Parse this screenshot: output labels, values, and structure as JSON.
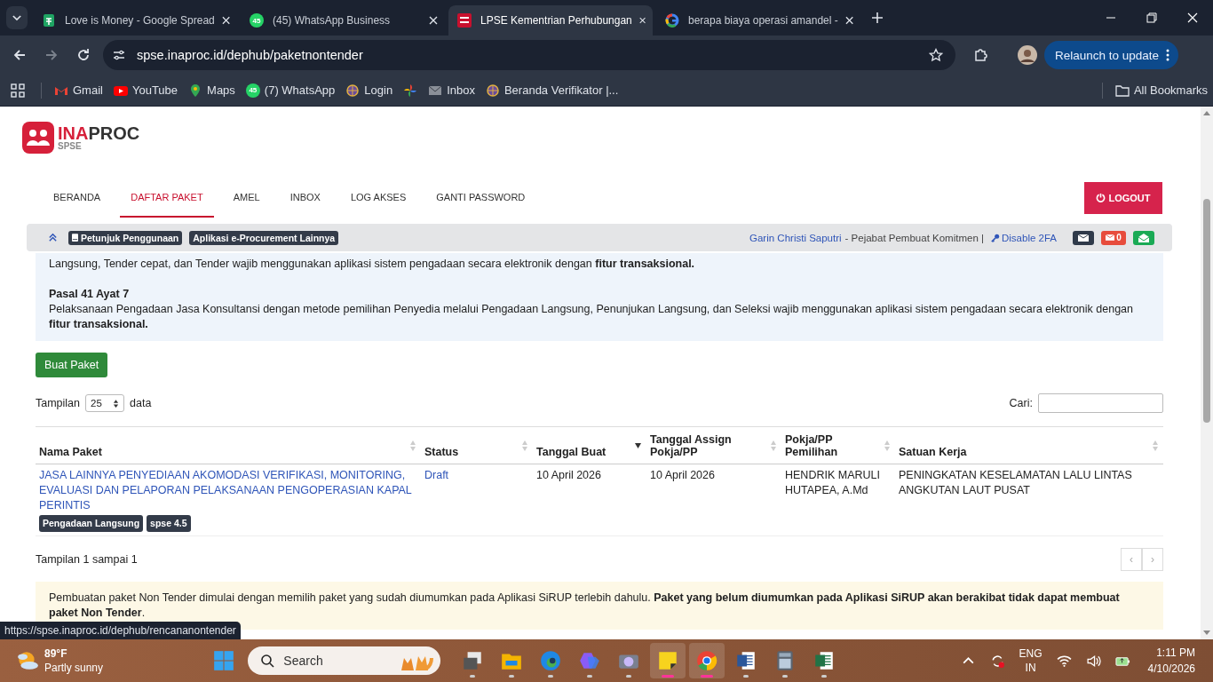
{
  "browser": {
    "tabs": [
      {
        "title": "Love is Money - Google Spread",
        "selected": false
      },
      {
        "title": "(45) WhatsApp Business",
        "badge": "45",
        "selected": false
      },
      {
        "title": "LPSE Kementrian Perhubungan",
        "selected": true
      },
      {
        "title": "berapa biaya operasi amandel -",
        "selected": false
      }
    ],
    "url": "spse.inaproc.id/dephub/paketnontender",
    "relaunch": "Relaunch to update",
    "bookmarks": [
      {
        "label": "Gmail"
      },
      {
        "label": "YouTube"
      },
      {
        "label": "Maps"
      },
      {
        "label": "(7) WhatsApp",
        "badge": "45"
      },
      {
        "label": "Login"
      },
      {
        "label": "Inbox"
      },
      {
        "label": "Beranda Verifikator |..."
      }
    ],
    "all_bookmarks": "All Bookmarks"
  },
  "site": {
    "logo": {
      "part_1": "INA",
      "part_2": "PROC",
      "sub": "SPSE"
    },
    "nav": [
      {
        "label": "BERANDA",
        "selected": false
      },
      {
        "label": "DAFTAR PAKET",
        "selected": true
      },
      {
        "label": "AMEL",
        "selected": false
      },
      {
        "label": "INBOX",
        "selected": false
      },
      {
        "label": "LOG AKSES",
        "selected": false
      },
      {
        "label": "GANTI PASSWORD",
        "selected": false
      }
    ],
    "logout": "LOGOUT",
    "toolbar": {
      "links": [
        "Petunjuk Penggunaan",
        "Aplikasi e-Procurement Lainnya"
      ],
      "user": "Garin Christi Saputri",
      "role": "- Pejabat Pembuat Komitmen |",
      "twofa": "Disable 2FA",
      "unread": "0"
    },
    "info": [
      {
        "text": "Langsung, Tender cepat, dan Tender wajib menggunakan aplikasi sistem pengadaan secara elektronik dengan **fitur transaksional.**"
      },
      {
        "heading": "Pasal 41 Ayat 7",
        "text": "Pelaksanaan Pengadaan Jasa Konsultansi dengan metode pemilihan Penyedia melalui Pengadaan Langsung, Penunjukan Langsung, dan Seleksi wajib menggunakan aplikasi sistem pengadaan secara elektronik dengan **fitur transaksional.**"
      }
    ],
    "create_button": "Buat Paket",
    "length": {
      "prefix": "Tampilan",
      "value": "25",
      "suffix": "data"
    },
    "search_label": "Cari:",
    "table": {
      "columns": [
        {
          "label": "Nama Paket",
          "sorted": false
        },
        {
          "label": "Status",
          "sorted": false
        },
        {
          "label": "Tanggal Buat",
          "sorted": true
        },
        {
          "label": "Tanggal Assign Pokja/PP",
          "sorted": false
        },
        {
          "label": "Pokja/PP Pemilihan",
          "sorted": false
        },
        {
          "label": "Satuan Kerja",
          "sorted": false
        }
      ],
      "rows": [
        {
          "name": "JASA LAINNYA PENYEDIAAN AKOMODASI VERIFIKASI, MONITORING, EVALUASI DAN PELAPORAN PELAKSANAAN PENGOPERASIAN KAPAL PERINTIS",
          "badges": [
            "Pengadaan Langsung",
            "spse 4.5"
          ],
          "status": "Draft",
          "created": "10 April 2026",
          "assigned": "10 April 2026",
          "pokja": "HENDRIK MARULI HUTAPEA, A.Md",
          "unit": "PENINGKATAN KESELAMATAN LALU LINTAS ANGKUTAN LAUT PUSAT"
        }
      ]
    },
    "table_info": "Tampilan 1 sampai 1",
    "pager": {
      "prev": "‹",
      "next": "›",
      "disabled": true
    },
    "notice": "Pembuatan paket Non Tender dimulai dengan memilih paket yang sudah diumumkan pada Aplikasi SiRUP terlebih dahulu. **Paket yang belum diumumkan pada Aplikasi SiRUP akan berakibat tidak dapat membuat paket Non Tender**."
  },
  "status_url": "https://spse.inaproc.id/dephub/rencananontender",
  "taskbar": {
    "weather": {
      "temp": "89°F",
      "desc": "Partly sunny"
    },
    "search": "Search",
    "apps": [
      {
        "kind": "taskview",
        "selected": false
      },
      {
        "kind": "explorer",
        "selected": false
      },
      {
        "kind": "edge",
        "selected": false
      },
      {
        "kind": "copilot",
        "selected": false
      },
      {
        "kind": "camera",
        "selected": false
      },
      {
        "kind": "sticky",
        "selected": true
      },
      {
        "kind": "chrome",
        "selected": true
      },
      {
        "kind": "word",
        "selected": false
      },
      {
        "kind": "calculator",
        "selected": false
      },
      {
        "kind": "excel",
        "selected": false
      }
    ],
    "lang": [
      "ENG",
      "IN"
    ],
    "time": "1:11 PM",
    "date": "4/10/2026"
  }
}
